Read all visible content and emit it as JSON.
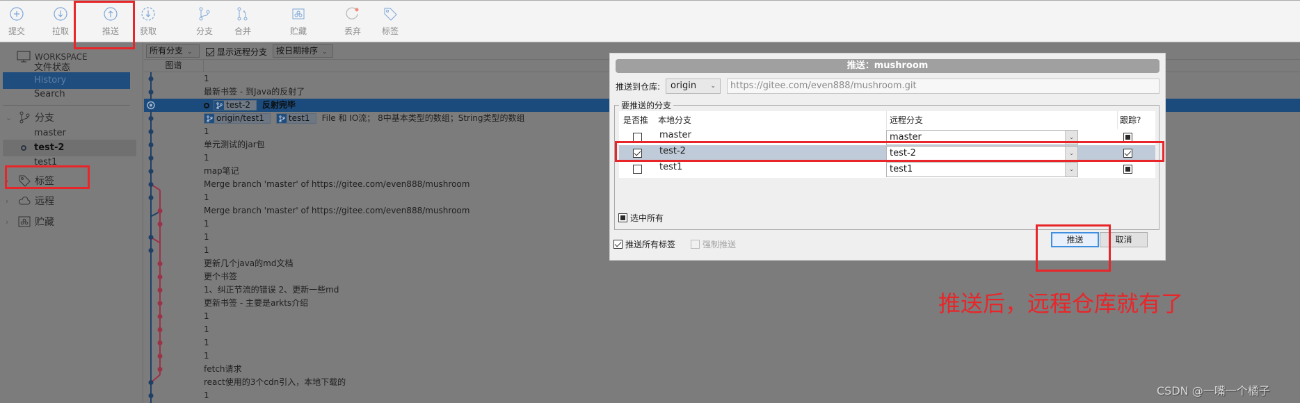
{
  "toolbar": {
    "buttons": [
      {
        "label": "提交",
        "icon": "plus-circle-icon"
      },
      {
        "label": "拉取",
        "icon": "arrow-down-circle-icon"
      },
      {
        "label": "推送",
        "icon": "arrow-up-circle-icon"
      },
      {
        "label": "获取",
        "icon": "arrow-down-dashed-circle-icon"
      },
      {
        "label": "分支",
        "icon": "branch-icon"
      },
      {
        "label": "合并",
        "icon": "merge-icon"
      },
      {
        "label": "贮藏",
        "icon": "stash-icon"
      },
      {
        "label": "丢弃",
        "icon": "discard-icon"
      },
      {
        "label": "标签",
        "icon": "tag-icon"
      }
    ]
  },
  "sidebar": {
    "workspace_label": "WORKSPACE",
    "workspace_items": [
      "文件状态",
      "History",
      "Search"
    ],
    "active_item": "History",
    "branches_label": "分支",
    "branches": [
      "master",
      "test-2",
      "test1"
    ],
    "current_branch": "test-2",
    "tags_label": "标签",
    "remotes_label": "远程",
    "stashes_label": "贮藏"
  },
  "history": {
    "branch_filter": "所有分支",
    "show_remote_label": "显示远程分支",
    "show_remote_checked": true,
    "sort": "按日期排序",
    "graph_header": "图谱",
    "commits": [
      {
        "message": "1"
      },
      {
        "message": "最新书签 - 到Java的反射了"
      },
      {
        "message": "反射完毕",
        "branches": [
          "test-2"
        ],
        "head": true,
        "selected": true
      },
      {
        "message": "File 和  IO流；  8中基本类型的数组；String类型的数组",
        "branches": [
          "origin/test1",
          "test1"
        ]
      },
      {
        "message": "1"
      },
      {
        "message": "单元测试的jar包"
      },
      {
        "message": "1"
      },
      {
        "message": "map笔记"
      },
      {
        "message": "Merge branch 'master' of https://gitee.com/even888/mushroom"
      },
      {
        "message": "1"
      },
      {
        "message": "Merge branch 'master' of https://gitee.com/even888/mushroom"
      },
      {
        "message": "1"
      },
      {
        "message": "1"
      },
      {
        "message": "1"
      },
      {
        "message": "更新几个java的md文档"
      },
      {
        "message": "更个书签"
      },
      {
        "message": "1、纠正节流的错误    2、更新一些md"
      },
      {
        "message": "更新书签 - 主要是arkts介绍"
      },
      {
        "message": "1"
      },
      {
        "message": "1"
      },
      {
        "message": "1"
      },
      {
        "message": "1"
      },
      {
        "message": "fetch请求"
      },
      {
        "message": "react使用的3个cdn引入，本地下载的"
      },
      {
        "message": "1"
      }
    ]
  },
  "dialog": {
    "title": "推送：mushroom",
    "repo_label": "推送到仓库:",
    "repo_value": "origin",
    "repo_url": "https://gitee.com/even888/mushroom.git",
    "group_label": "要推送的分支",
    "columns": {
      "push": "是否推",
      "local": "本地分支",
      "remote": "远程分支",
      "track": "跟踪?"
    },
    "rows": [
      {
        "push": false,
        "local": "master",
        "remote": "master",
        "track": "indeterminate"
      },
      {
        "push": true,
        "local": "test-2",
        "remote": "test-2",
        "track": "checked",
        "selected": true
      },
      {
        "push": false,
        "local": "test1",
        "remote": "test1",
        "track": "indeterminate"
      }
    ],
    "select_all_label": "选中所有",
    "push_all_tags_label": "推送所有标签",
    "push_all_tags_checked": true,
    "force_push_label": "强制推送",
    "force_push_checked": false,
    "push_button": "推送",
    "cancel_button": "取消"
  },
  "annotation": {
    "text": "推送后，远程仓库就有了",
    "color": "#e8262a"
  },
  "watermark": "CSDN @一嘴一个橘子",
  "colors": {
    "accent_blue": "#1b4b7c",
    "graph_blue": "#1f3f66",
    "graph_red": "#9b3348",
    "push_button_border": "#3f8fe0"
  }
}
